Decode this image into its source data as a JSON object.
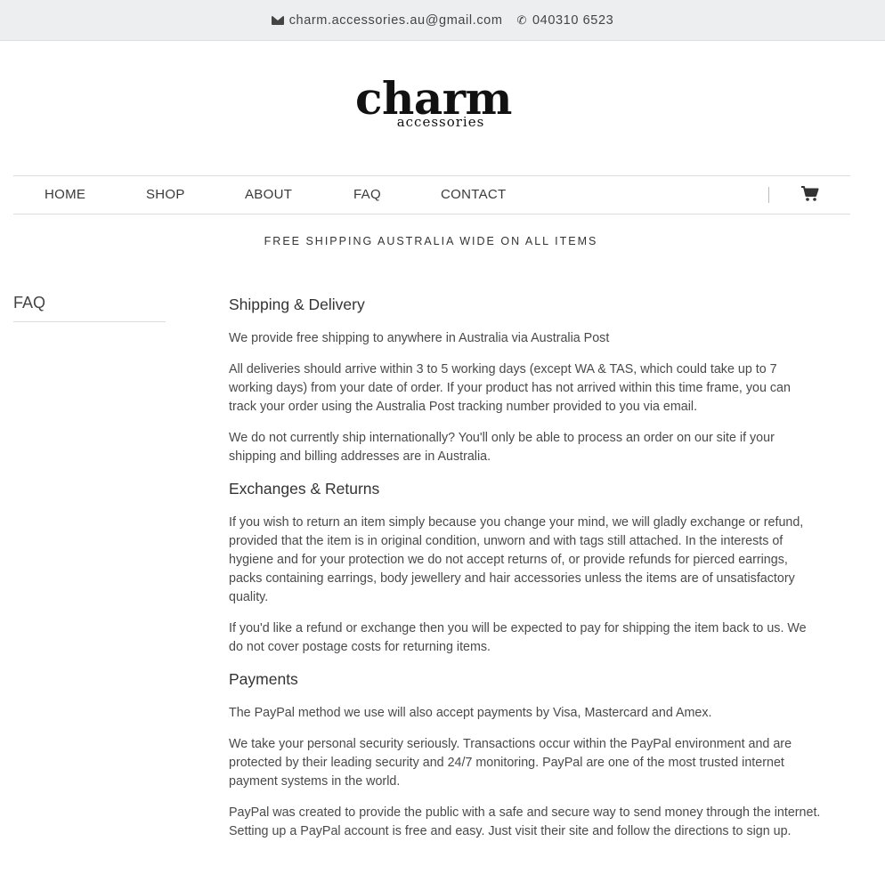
{
  "topbar": {
    "email": "charm.accessories.au@gmail.com",
    "phone": "040310 6523",
    "email_icon": "envelope-icon",
    "phone_icon": "phone-icon"
  },
  "logo": {
    "main": "charm",
    "sub": "accessories"
  },
  "nav": {
    "items": [
      {
        "label": "HOME"
      },
      {
        "label": "SHOP"
      },
      {
        "label": "ABOUT"
      },
      {
        "label": "FAQ"
      },
      {
        "label": "CONTACT"
      }
    ],
    "cart_icon": "shopping-cart-icon"
  },
  "banner": {
    "text": "FREE SHIPPING AUSTRALIA WIDE ON ALL ITEMS"
  },
  "sidebar": {
    "title": "FAQ"
  },
  "faq": {
    "sections": [
      {
        "heading": "Shipping & Delivery",
        "paragraphs": [
          "We provide free shipping to anywhere in Australia via Australia Post",
          "All deliveries should arrive within 3 to 5 working days (except WA & TAS, which could take up to 7 working days) from your date of order. If your product has not arrived within this time frame, you can track your order using the Australia Post tracking number provided to you via email.",
          "We do not currently ship internationally? You'll only be able to process an order on our site if your shipping and billing addresses are in Australia."
        ]
      },
      {
        "heading": "Exchanges & Returns",
        "paragraphs": [
          "If you wish to return an item simply because you change your mind, we will gladly exchange or refund, provided that the item is in original condition, unworn and with tags still attached. In the interests of hygiene and for your protection we do not accept returns of, or provide refunds for pierced earrings, packs containing earrings, body jewellery and hair accessories unless the items are of unsatisfactory quality.",
          "If you'd like a refund or exchange then you will be expected to pay for shipping the item back to us. We do not cover postage costs for returning items."
        ]
      },
      {
        "heading": "Payments",
        "paragraphs": [
          "The PayPal method we use will also accept payments by Visa, Mastercard and Amex.",
          "We take your personal security seriously. Transactions occur within the PayPal environment and are protected by their leading security and 24/7 monitoring. PayPal are one of the most trusted internet payment systems in the world.",
          "PayPal was created to provide the public with a safe and secure way to send money through the internet. Setting up a PayPal account is free and easy. Just visit their site and follow the directions to sign up."
        ]
      }
    ]
  }
}
